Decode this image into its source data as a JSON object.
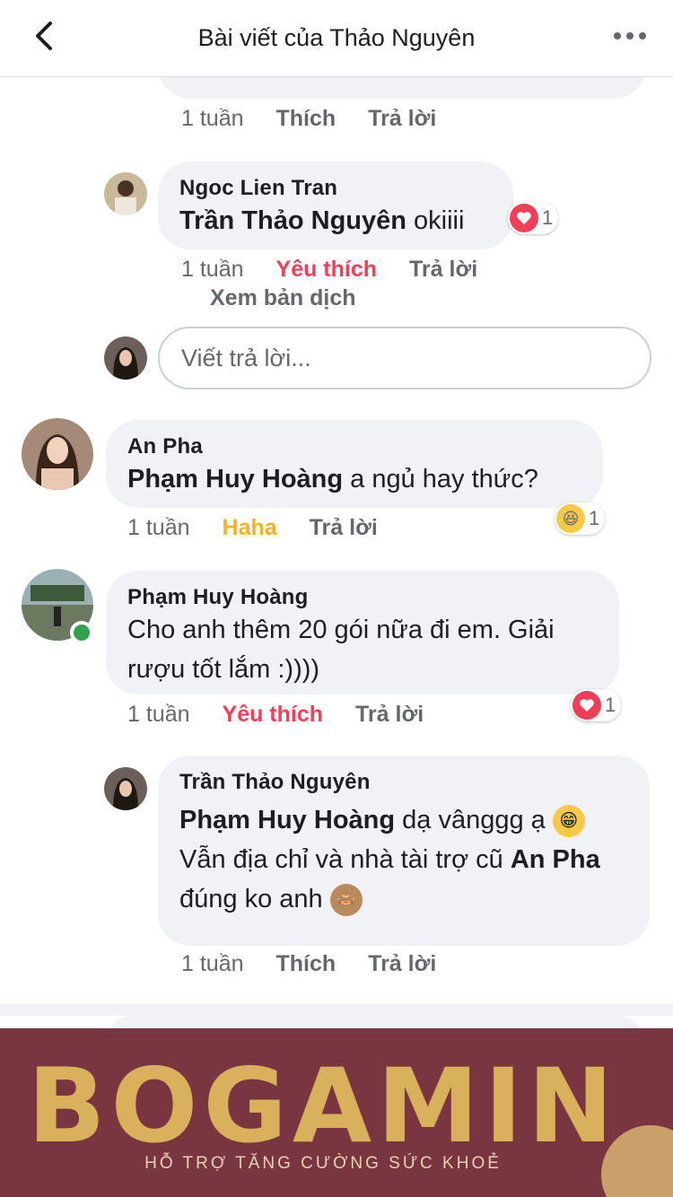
{
  "header": {
    "title": "Bài viết của Thảo Nguyên"
  },
  "top": {
    "time": "1 tuần",
    "like": "Thích",
    "reply": "Trả lời"
  },
  "c1": {
    "name": "Ngoc Lien Tran",
    "mention": "Trần Thảo Nguyên",
    "text": " okiiii",
    "reaction_count": "1",
    "time": "1 tuần",
    "like": "Yêu thích",
    "reply": "Trả lời",
    "translate": "Xem bản dịch"
  },
  "reply_input": {
    "placeholder": "Viết trả lời..."
  },
  "c2": {
    "name": "An Pha",
    "mention": "Phạm Huy Hoàng",
    "text": "  a ngủ hay thức?",
    "reaction_count": "1",
    "time": "1 tuần",
    "like": "Haha",
    "reply": "Trả lời"
  },
  "c3": {
    "name": "Phạm Huy Hoàng",
    "text": "Cho anh thêm 20 gói nữa đi em. Giải rượu tốt lắm :))))",
    "reaction_count": "1",
    "time": "1 tuần",
    "like": "Yêu thích",
    "reply": "Trả lời"
  },
  "c4": {
    "name": "Trần Thảo Nguyên",
    "mention1": "Phạm Huy Hoàng",
    "text1": " dạ vânggg ạ ",
    "text2": "Vẫn địa chỉ và nhà tài trợ cũ ",
    "mention2": "An Pha",
    "text3": " đúng ko anh ",
    "time": "1 tuần",
    "like": "Thích",
    "reply": "Trả lời"
  },
  "banner": {
    "brand": "BOGAMIN",
    "tagline": "HỖ TRỢ TĂNG CƯỜNG SỨC KHOẺ"
  },
  "colors": {
    "love": "#f33e58",
    "haha": "#f7b125",
    "bubble": "#f0f2f5",
    "banner": "#7a3640",
    "online": "#31a24c"
  }
}
